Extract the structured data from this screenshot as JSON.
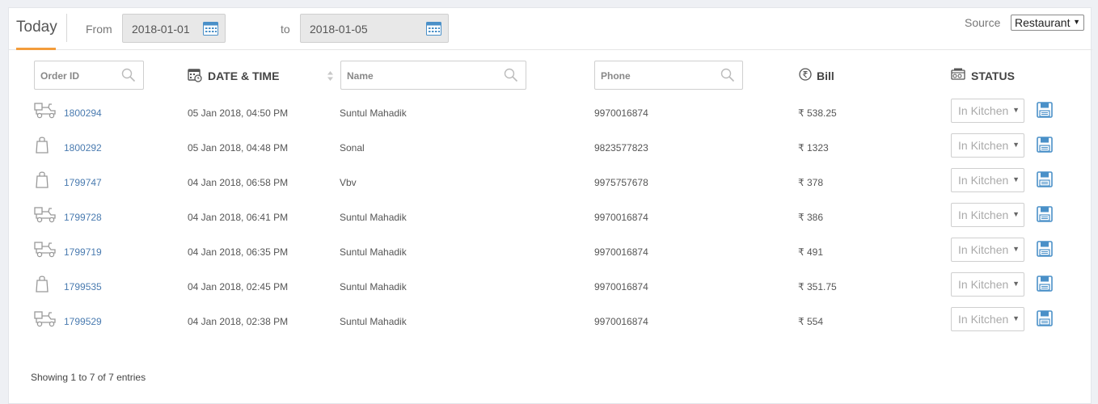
{
  "topbar": {
    "tab_label": "Today",
    "from_label": "From",
    "from_date": "2018-01-01",
    "to_label": "to",
    "to_date": "2018-01-05",
    "source_label": "Source",
    "source_value": "Restaurant"
  },
  "filters": {
    "order_id_placeholder": "Order ID",
    "name_placeholder": "Name",
    "phone_placeholder": "Phone"
  },
  "columns": {
    "date_time": "DATE & TIME",
    "bill": "Bill",
    "status": "STATUS"
  },
  "currency_symbol": "₹",
  "rows": [
    {
      "type": "delivery-icon",
      "order_id": "1800294",
      "date_time": "05 Jan 2018, 04:50 PM",
      "name": "Suntul Mahadik",
      "phone": "9970016874",
      "bill": "₹ 538.25",
      "status": "In Kitchen"
    },
    {
      "type": "bag-icon",
      "order_id": "1800292",
      "date_time": "05 Jan 2018, 04:48 PM",
      "name": "Sonal",
      "phone": "9823577823",
      "bill": "₹ 1323",
      "status": "In Kitchen"
    },
    {
      "type": "bag-icon",
      "order_id": "1799747",
      "date_time": "04 Jan 2018, 06:58 PM",
      "name": "Vbv",
      "phone": "9975757678",
      "bill": "₹ 378",
      "status": "In Kitchen"
    },
    {
      "type": "delivery-icon",
      "order_id": "1799728",
      "date_time": "04 Jan 2018, 06:41 PM",
      "name": "Suntul Mahadik",
      "phone": "9970016874",
      "bill": "₹ 386",
      "status": "In Kitchen"
    },
    {
      "type": "delivery-icon",
      "order_id": "1799719",
      "date_time": "04 Jan 2018, 06:35 PM",
      "name": "Suntul Mahadik",
      "phone": "9970016874",
      "bill": "₹ 491",
      "status": "In Kitchen"
    },
    {
      "type": "bag-icon",
      "order_id": "1799535",
      "date_time": "04 Jan 2018, 02:45 PM",
      "name": "Suntul Mahadik",
      "phone": "9970016874",
      "bill": "₹ 351.75",
      "status": "In Kitchen"
    },
    {
      "type": "delivery-icon",
      "order_id": "1799529",
      "date_time": "04 Jan 2018, 02:38 PM",
      "name": "Suntul Mahadik",
      "phone": "9970016874",
      "bill": "₹ 554",
      "status": "In Kitchen"
    }
  ],
  "footer": {
    "info": "Showing 1 to 7 of 7 entries"
  },
  "colors": {
    "accent": "#f39c3b",
    "link": "#4a7bb0",
    "icon_blue": "#4a90c8"
  }
}
